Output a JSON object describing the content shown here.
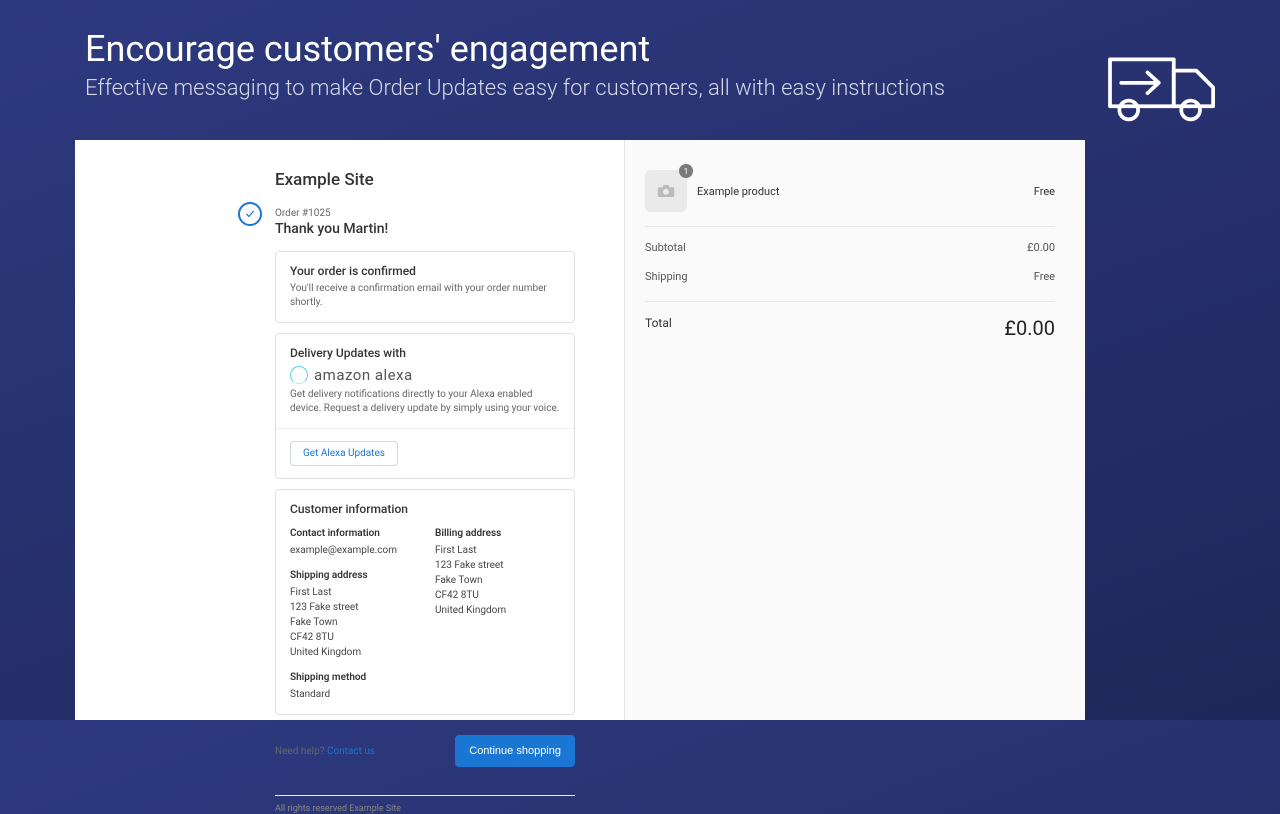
{
  "hero": {
    "title": "Encourage customers' engagement",
    "subtitle": "Effective messaging to make Order Updates easy for customers, all with easy instructions"
  },
  "checkout": {
    "site_name": "Example Site",
    "order_number": "Order #1025",
    "thank_you": "Thank you Martin!",
    "confirmed_title": "Your order is confirmed",
    "confirmed_sub": "You'll receive a confirmation email with your order number shortly.",
    "alexa_title": "Delivery Updates with",
    "alexa_brand": "amazon alexa",
    "alexa_desc": "Get delivery notifications directly to your Alexa enabled device. Request a delivery update by simply using your voice.",
    "alexa_button": "Get Alexa Updates",
    "customer_info_title": "Customer information",
    "contact": {
      "heading": "Contact information",
      "email": "example@example.com"
    },
    "shipping_address": {
      "heading": "Shipping address",
      "name": "First Last",
      "line1": "123 Fake street",
      "city": "Fake Town",
      "postcode": "CF42 8TU",
      "country": "United Kingdom"
    },
    "billing_address": {
      "heading": "Billing address",
      "name": "First Last",
      "line1": "123 Fake street",
      "city": "Fake Town",
      "postcode": "CF42 8TU",
      "country": "United Kingdom"
    },
    "shipping_method": {
      "heading": "Shipping method",
      "value": "Standard"
    },
    "help_text": "Need help? ",
    "contact_link": "Contact us",
    "continue_button": "Continue shopping",
    "rights": "All rights reserved Example Site"
  },
  "summary": {
    "product_qty": "1",
    "product_name": "Example product",
    "product_price": "Free",
    "subtotal_label": "Subtotal",
    "subtotal_value": "£0.00",
    "shipping_label": "Shipping",
    "shipping_value": "Free",
    "total_label": "Total",
    "total_value": "£0.00"
  }
}
